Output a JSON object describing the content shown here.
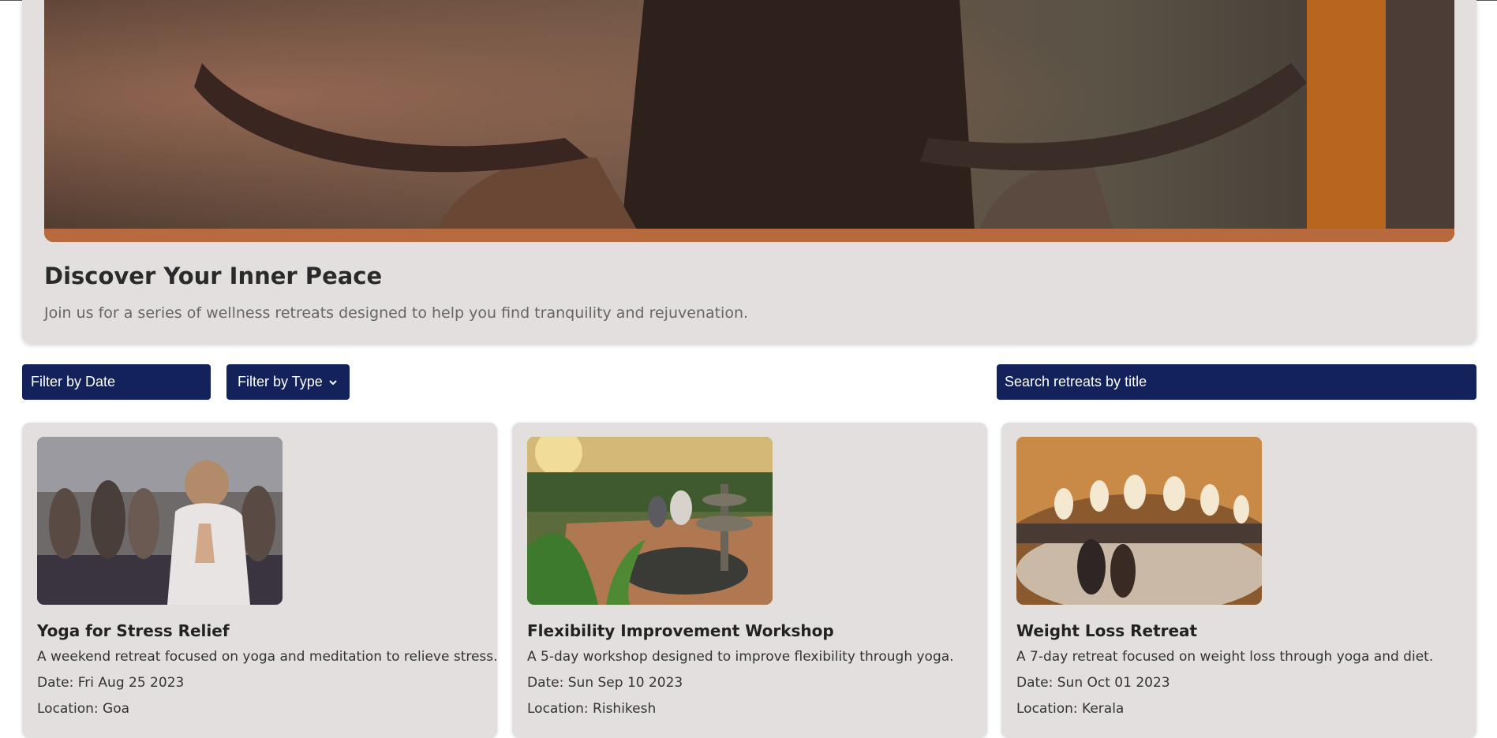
{
  "hero": {
    "title": "Discover Your Inner Peace",
    "subtitle": "Join us for a series of wellness retreats designed to help you find tranquility and rejuvenation."
  },
  "filters": {
    "date_label": "Filter by Date",
    "type_label": "Filter by Type",
    "search_placeholder": "Search retreats by title"
  },
  "colors": {
    "control_bg": "#13225a",
    "panel_bg": "#e3dfdf"
  },
  "retreats": [
    {
      "title": "Yoga for Stress Relief",
      "description": "A weekend retreat focused on yoga and meditation to relieve stress.",
      "date": "Date: Fri Aug 25 2023",
      "location": "Location: Goa"
    },
    {
      "title": "Flexibility Improvement Workshop",
      "description": "A 5-day workshop designed to improve flexibility through yoga.",
      "date": "Date: Sun Sep 10 2023",
      "location": "Location: Rishikesh"
    },
    {
      "title": "Weight Loss Retreat",
      "description": "A 7-day retreat focused on weight loss through yoga and diet.",
      "date": "Date: Sun Oct 01 2023",
      "location": "Location: Kerala"
    }
  ]
}
